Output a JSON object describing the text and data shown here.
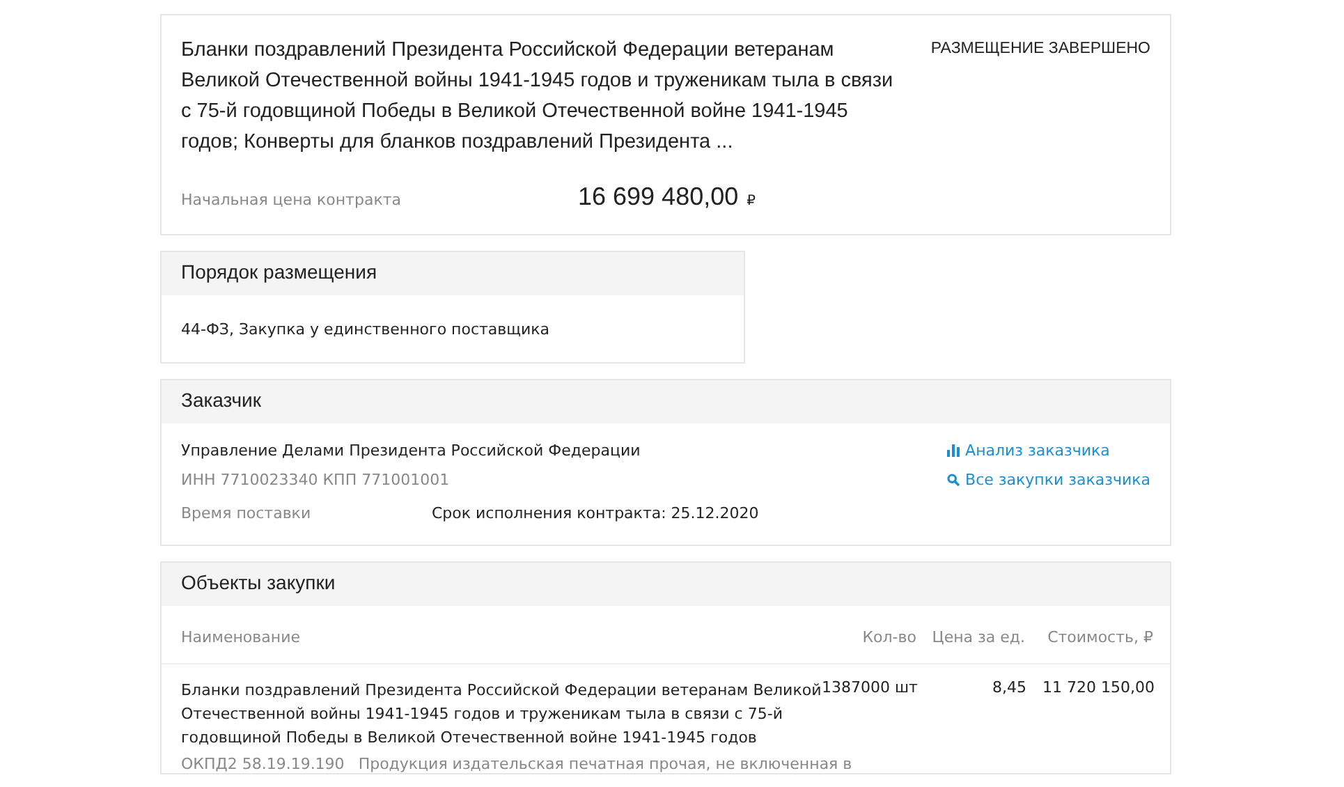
{
  "summary": {
    "title": "Бланки поздравлений Президента Российской Федерации ветеранам Великой Отечественной войны 1941-1945 годов и труженикам тыла в связи с 75-й годовщиной Победы в Великой Отечественной войне 1941-1945 годов; Конверты для бланков поздравлений Президента ...",
    "status": "РАЗМЕЩЕНИЕ ЗАВЕРШЕНО",
    "price_label": "Начальная цена контракта",
    "price": "16 699 480,00",
    "currency": "₽"
  },
  "placement": {
    "title": "Порядок размещения",
    "text": "44-ФЗ, Закупка у единственного поставщика"
  },
  "customer": {
    "title": "Заказчик",
    "name": "Управление Делами Президента Российской Федерации",
    "ids": "ИНН 7710023340 КПП 771001001",
    "delivery_label": "Время поставки",
    "delivery_value": "Срок исполнения контракта: 25.12.2020",
    "links": [
      {
        "kind": "chart",
        "label": "Анализ заказчика"
      },
      {
        "kind": "search",
        "label": "Все закупки заказчика"
      }
    ]
  },
  "objects": {
    "title": "Объекты закупки",
    "columns": [
      "Наименование",
      "Кол-во",
      "Цена за ед.",
      "Стоимость, ₽"
    ],
    "rows": [
      {
        "name": "Бланки поздравлений Президента Российской Федерации ветеранам Великой Отечественной войны 1941-1945 годов и труженикам тыла в связи с 75-й годовщиной Победы в Великой Отечественной войне 1941-1945 годов",
        "code": "ОКПД2 58.19.19.190",
        "code_text": "Продукция издательская печатная прочая, не включенная в",
        "qty": "1387000 шт",
        "unit_price": "8,45",
        "cost": "11 720 150,00"
      }
    ]
  }
}
